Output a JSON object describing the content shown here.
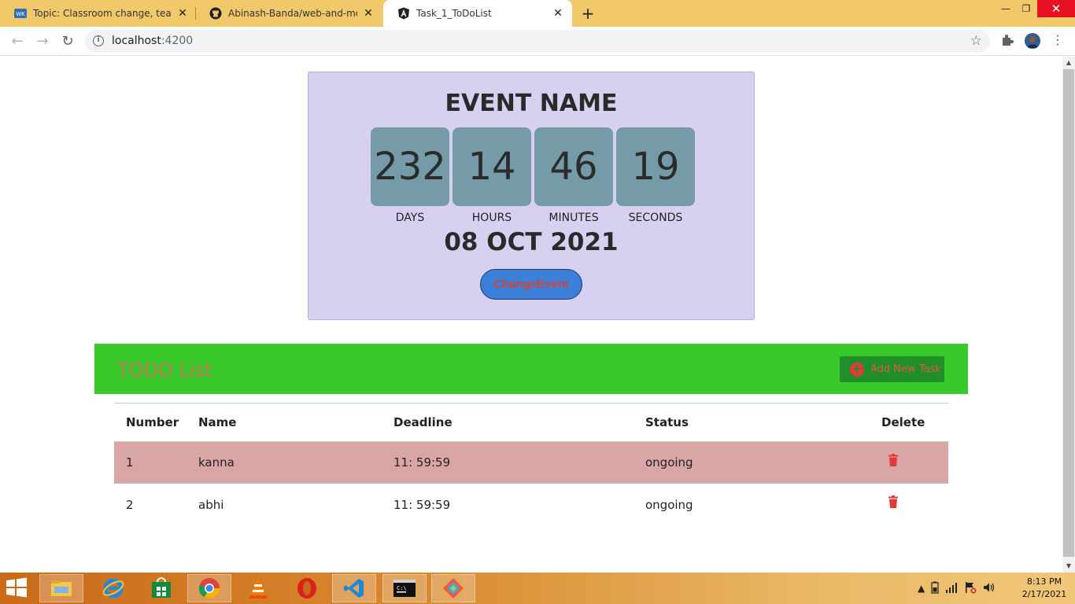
{
  "browser": {
    "tabs": [
      {
        "label": "Topic: Classroom change, team in",
        "icon": "moodle-icon",
        "active": false
      },
      {
        "label": "Abinash-Banda/web-and-mobile",
        "icon": "github-icon",
        "active": false
      },
      {
        "label": "Task_1_ToDoList",
        "icon": "angular-icon",
        "active": true
      }
    ],
    "close_glyph": "✕",
    "new_tab_glyph": "+",
    "url_host": "localhost",
    "url_port": ":4200",
    "window_buttons": {
      "minimize": "—",
      "maximize": "❐",
      "close": "✕"
    }
  },
  "event": {
    "title": "EVENT NAME",
    "countdown": [
      {
        "value": "232",
        "label": "DAYS"
      },
      {
        "value": "14",
        "label": "HOURS"
      },
      {
        "value": "46",
        "label": "MINUTES"
      },
      {
        "value": "19",
        "label": "SECONDS"
      }
    ],
    "date": "08 OCT 2021",
    "change_button": "ChangeEvent"
  },
  "todo": {
    "title": "TODO List",
    "add_button": "Add New Task",
    "add_icon": "plus-circle-icon",
    "columns": [
      "Number",
      "Name",
      "Deadline",
      "Status",
      "Delete"
    ],
    "rows": [
      {
        "number": "1",
        "name": "kanna",
        "deadline": "11: 59:59",
        "status": "ongoing",
        "delete_icon": "trash-icon"
      },
      {
        "number": "2",
        "name": "abhi",
        "deadline": "11: 59:59",
        "status": "ongoing",
        "delete_icon": "trash-icon"
      }
    ],
    "colors": {
      "header_bg": "#39c92b",
      "row_highlight": "#daa5a5",
      "trash": "#e03a3a"
    }
  },
  "taskbar": {
    "apps": [
      "file-explorer-icon",
      "internet-explorer-icon",
      "store-icon",
      "chrome-icon",
      "vlc-icon",
      "opera-icon",
      "vscode-icon",
      "terminal-icon",
      "git-icon"
    ],
    "clock_time": "8:13 PM",
    "clock_date": "2/17/2021"
  }
}
